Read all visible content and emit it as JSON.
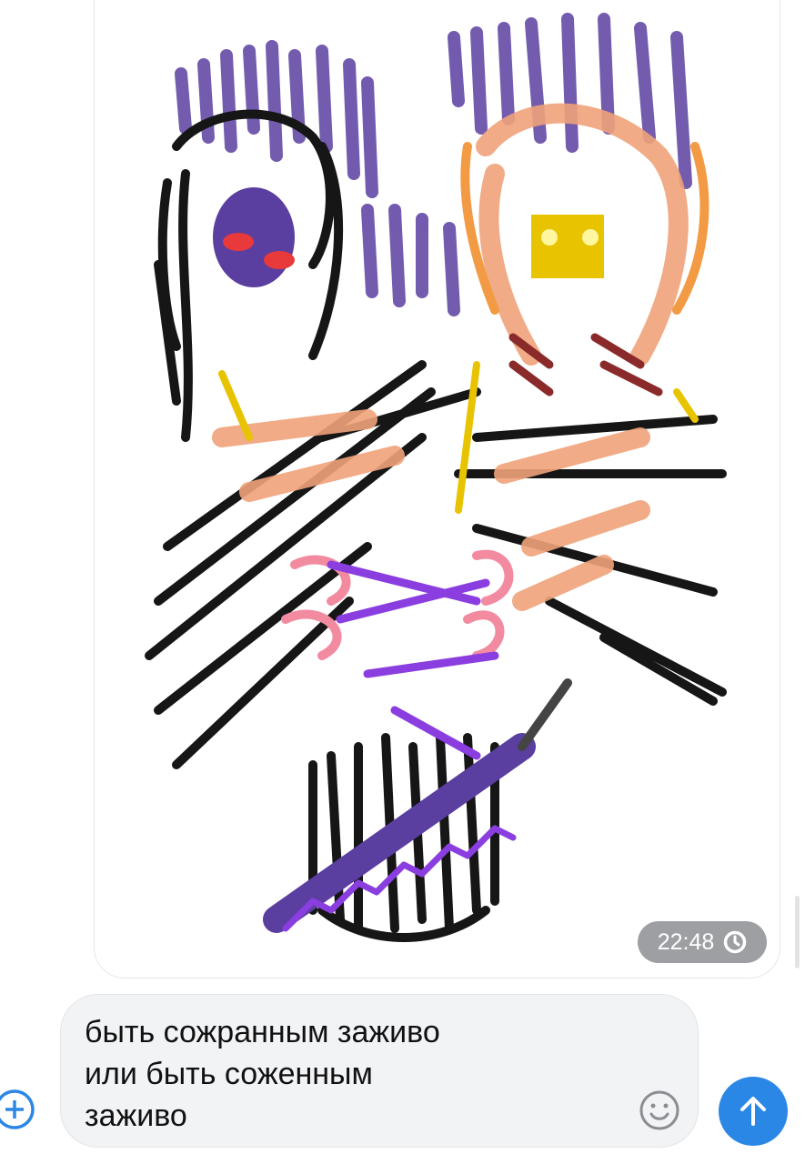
{
  "message": {
    "type": "drawing-image",
    "timestamp": "22:48",
    "status_icon": "clock-icon"
  },
  "composer": {
    "text": "быть сожранным заживо\nили быть соженным\nзаживо",
    "attach_icon": "plus-circle-icon",
    "emoji_icon": "smiley-icon",
    "send_icon": "arrow-up-icon"
  },
  "colors": {
    "accent": "#2b87e6",
    "timestamp_bg": "#9d9fa3",
    "composer_bg": "#f2f3f5"
  }
}
